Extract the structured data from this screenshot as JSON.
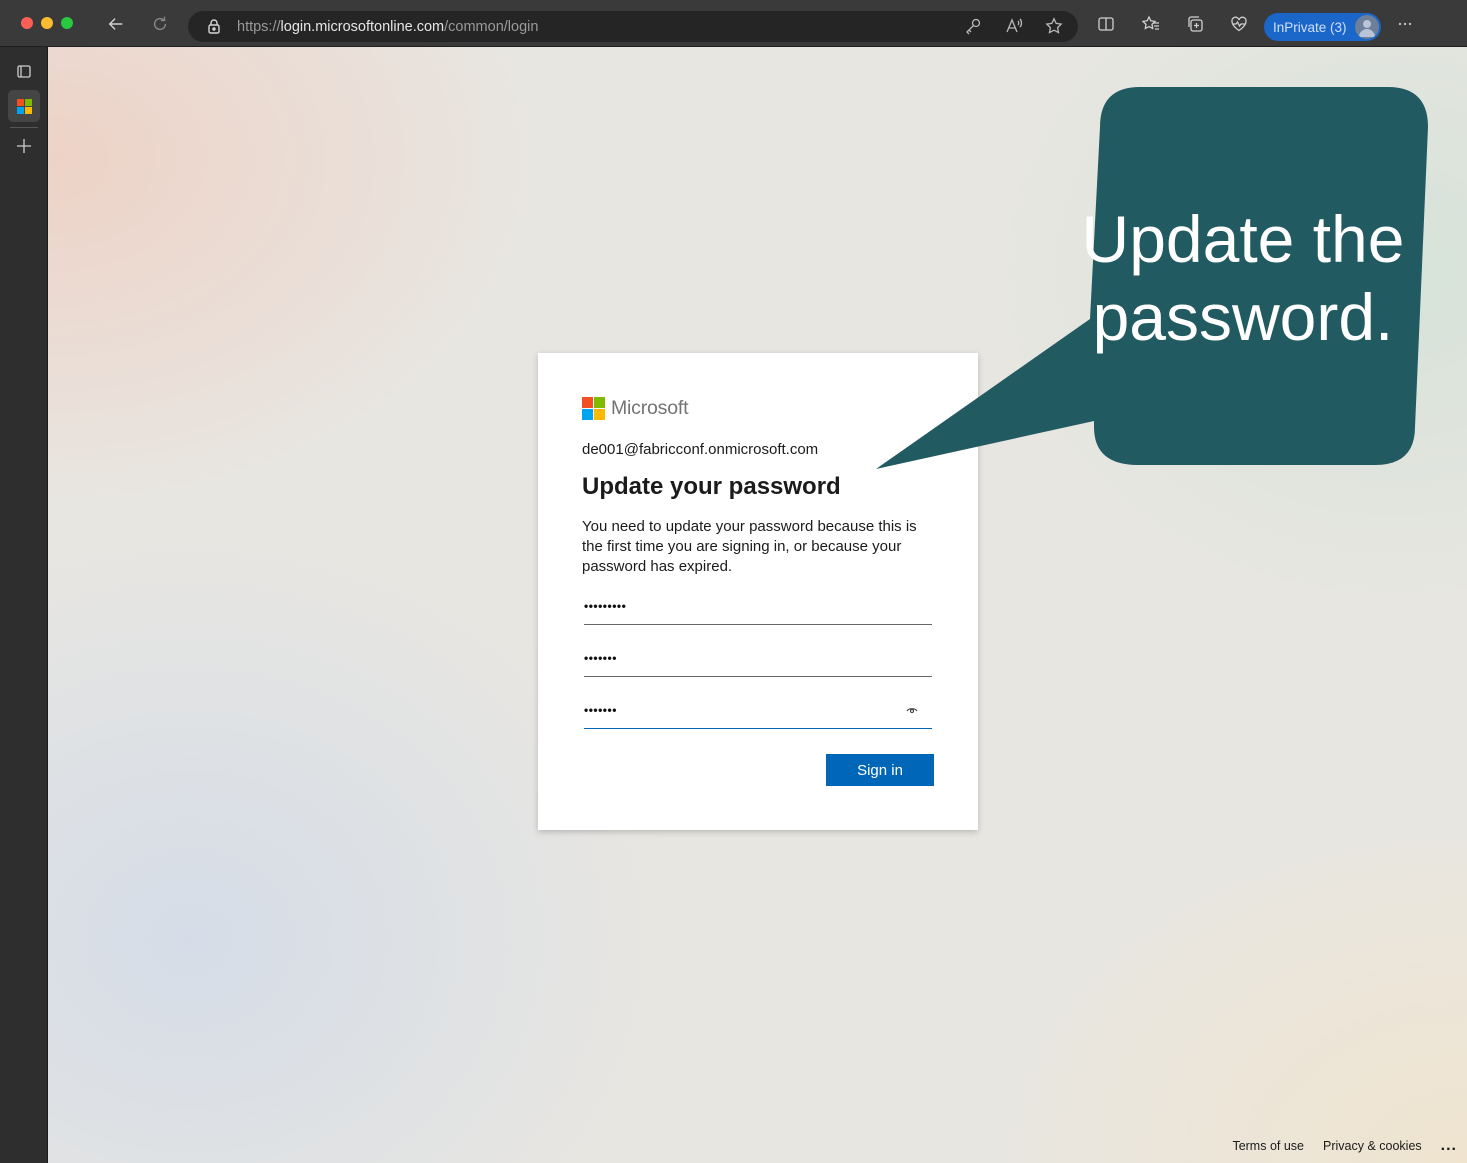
{
  "browser": {
    "url_prefix": "https://",
    "url_host": "login.microsoftonline.com",
    "url_path": "/common/login",
    "inprivate_label": "InPrivate (3)"
  },
  "card": {
    "brand": "Microsoft",
    "identity": "de001@fabricconf.onmicrosoft.com",
    "title": "Update your password",
    "description": "You need to update your password because this is the first time you are signing in, or because your password has expired.",
    "current_password_masked": "•••••••••",
    "new_password_masked": "•••••••",
    "confirm_password_masked": "•••••••",
    "sign_in_label": "Sign in"
  },
  "callout": {
    "line1": "Update the",
    "line2": "password.",
    "color": "#215a61"
  },
  "footer": {
    "terms": "Terms of use",
    "privacy": "Privacy & cookies",
    "more": "..."
  }
}
